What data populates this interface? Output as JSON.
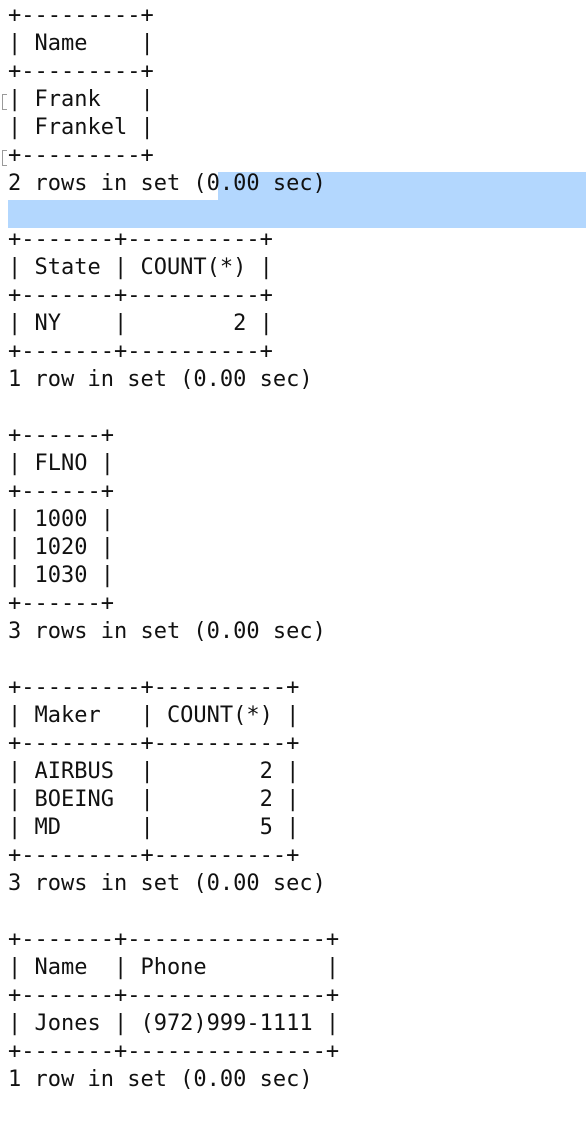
{
  "terminal": {
    "lines": [
      "+---------+",
      "| Name    |",
      "+---------+",
      "| Frank   |",
      "| Frankel |",
      "+---------+",
      "2 rows in set (0.00 sec)",
      "",
      "+-------+----------+",
      "| State | COUNT(*) |",
      "+-------+----------+",
      "| NY    |        2 |",
      "+-------+----------+",
      "1 row in set (0.00 sec)",
      "",
      "+------+",
      "| FLNO |",
      "+------+",
      "| 1000 |",
      "| 1020 |",
      "| 1030 |",
      "+------+",
      "3 rows in set (0.00 sec)",
      "",
      "+---------+----------+",
      "| Maker   | COUNT(*) |",
      "+---------+----------+",
      "| AIRBUS  |        2 |",
      "| BOEING  |        2 |",
      "| MD      |        5 |",
      "+---------+----------+",
      "3 rows in set (0.00 sec)",
      "",
      "+-------+---------------+",
      "| Name  | Phone         |",
      "+-------+---------------+",
      "| Jones | (972)999-1111 |",
      "+-------+---------------+",
      "1 row in set (0.00 sec)"
    ]
  },
  "colors": {
    "background": "#ffffff",
    "text": "#111111",
    "selection": "#b3d7fe"
  }
}
